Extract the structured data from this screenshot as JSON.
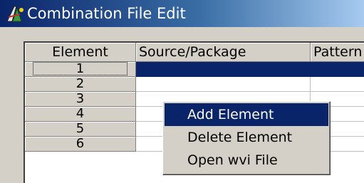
{
  "window": {
    "title": "Combination File Edit"
  },
  "grid": {
    "columns": [
      "Element",
      "Source/Package",
      "Pattern"
    ],
    "rows": [
      "1",
      "2",
      "3",
      "4",
      "5",
      "6"
    ],
    "selected_row": "1"
  },
  "context_menu": {
    "items": [
      "Add Element",
      "Delete Element",
      "Open wvi File"
    ],
    "highlighted": "Add Element"
  },
  "colors": {
    "selection": "#0a246a",
    "face": "#d4d0c8"
  }
}
